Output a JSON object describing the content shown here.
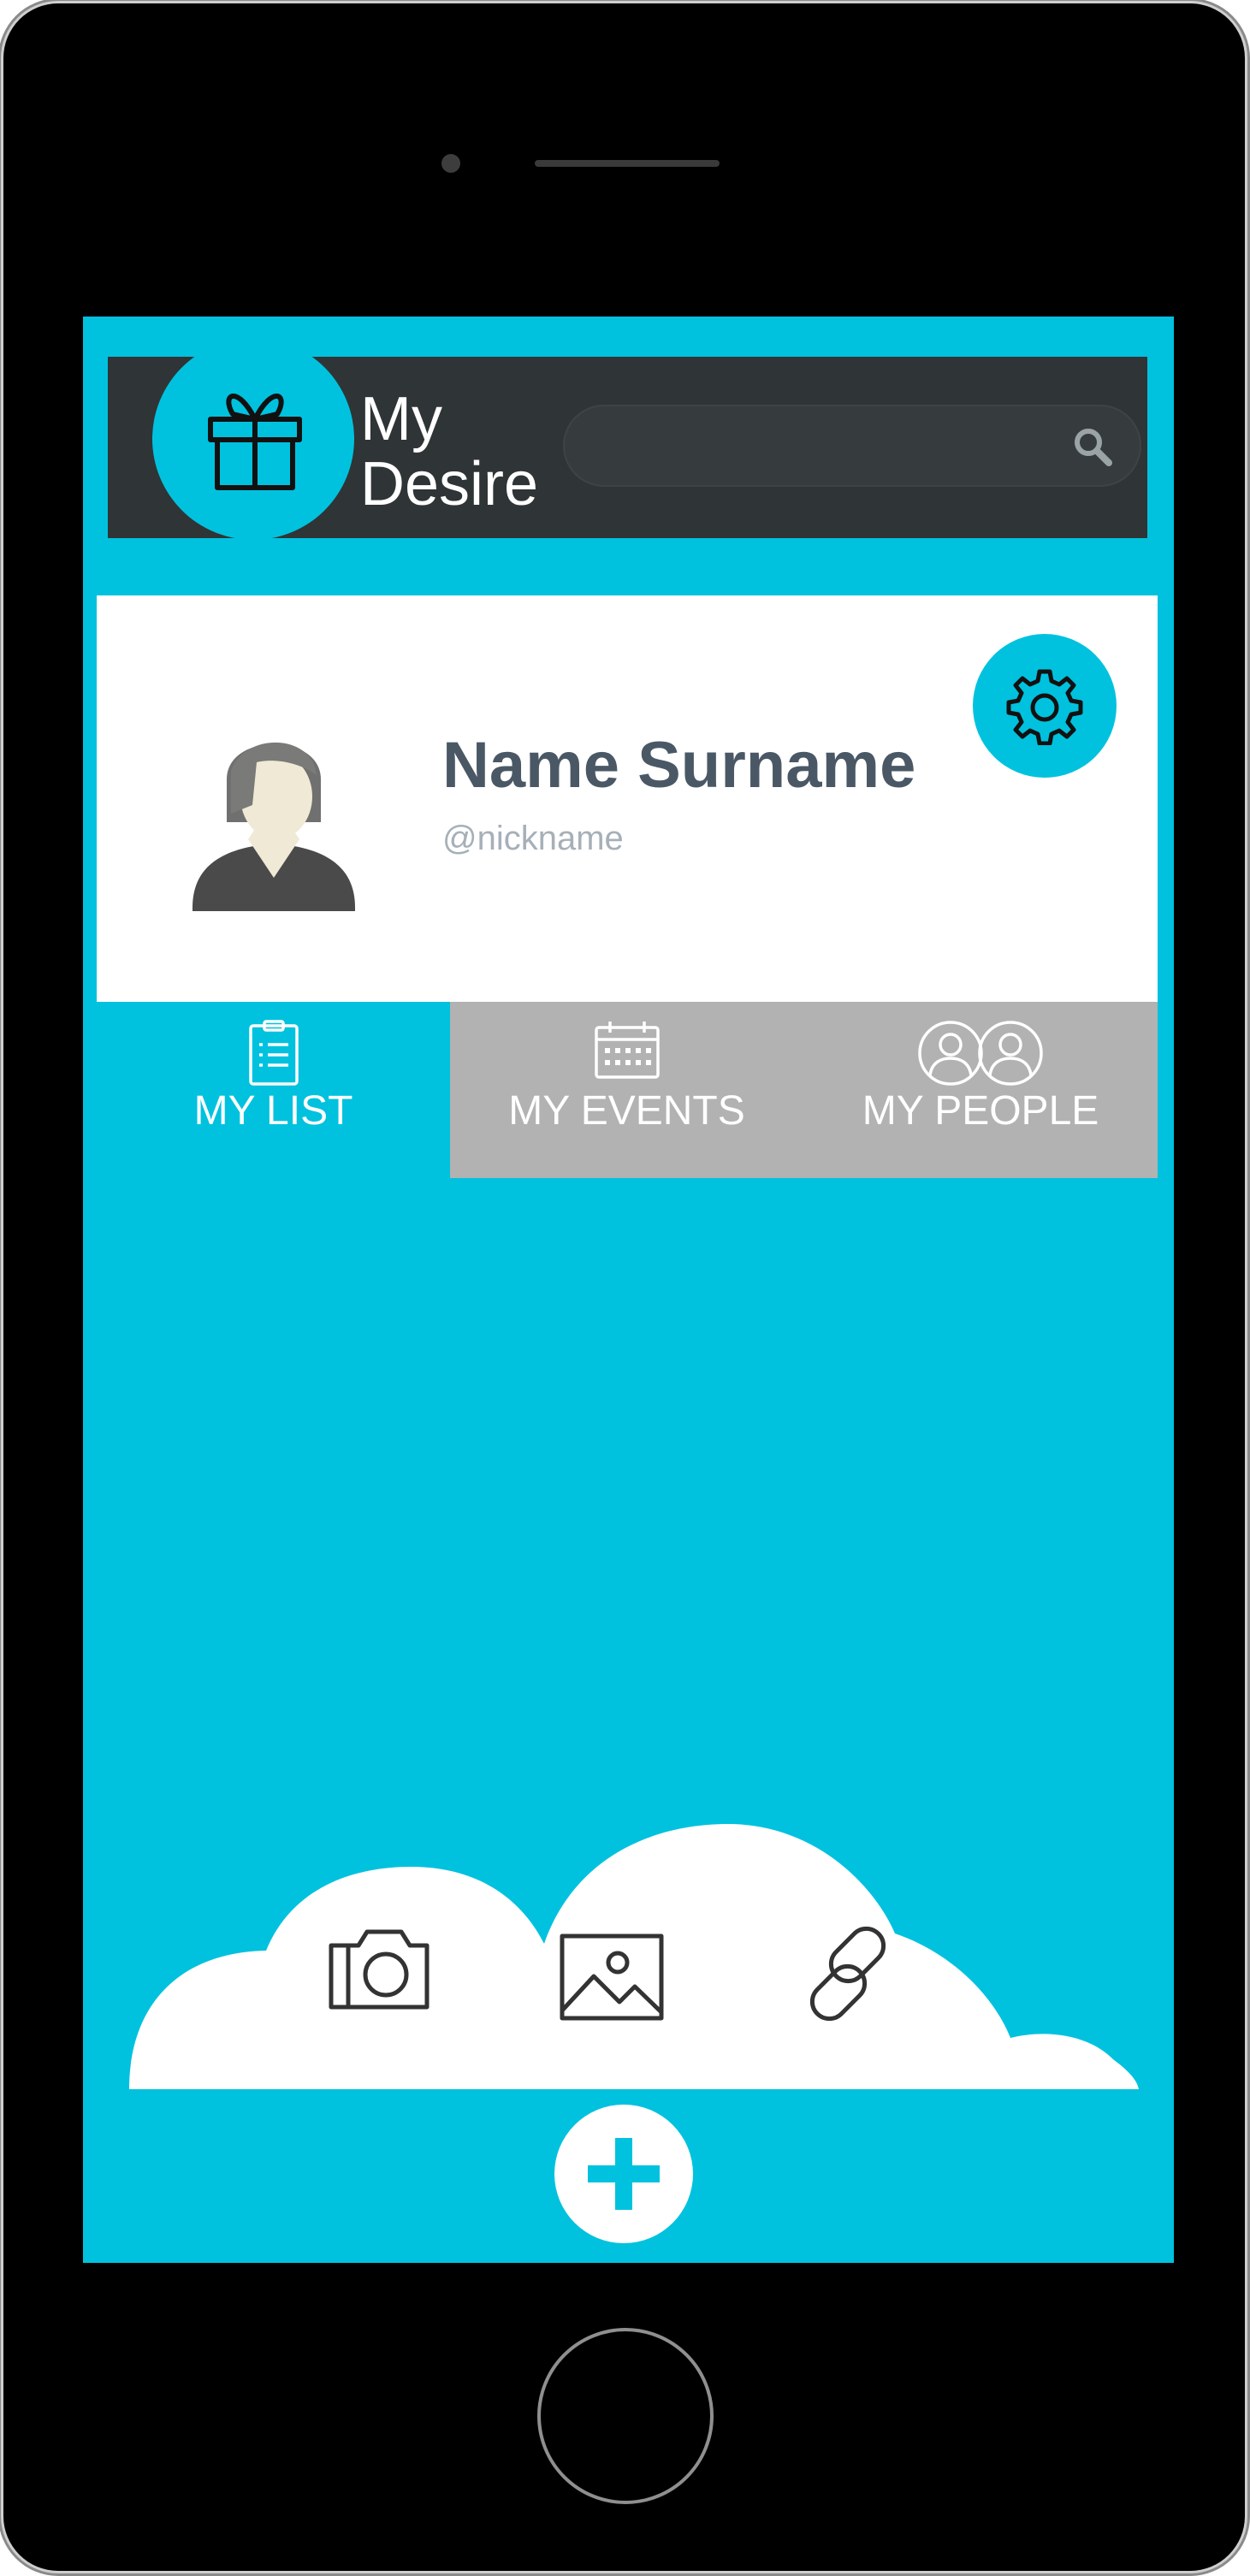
{
  "app": {
    "brand_line1": "My",
    "brand_line2": "Desire"
  },
  "search": {
    "placeholder": "",
    "value": "",
    "icon": "search-icon"
  },
  "profile": {
    "name": "Name Surname",
    "nickname": "@nickname",
    "settings_icon": "gear-icon"
  },
  "tabs": [
    {
      "label": "MY LIST",
      "icon": "clipboard-list-icon",
      "active": true
    },
    {
      "label": "MY EVENTS",
      "icon": "calendar-icon",
      "active": false
    },
    {
      "label": "MY PEOPLE",
      "icon": "people-icon",
      "active": false
    }
  ],
  "add_options": [
    {
      "icon": "camera-icon"
    },
    {
      "icon": "image-icon"
    },
    {
      "icon": "link-icon"
    }
  ],
  "colors": {
    "accent": "#00c2de",
    "header_bg": "#2f3436",
    "inactive_tab": "#b2b2b2",
    "name_text": "#4a5866",
    "nickname_text": "#a6b0b8"
  }
}
